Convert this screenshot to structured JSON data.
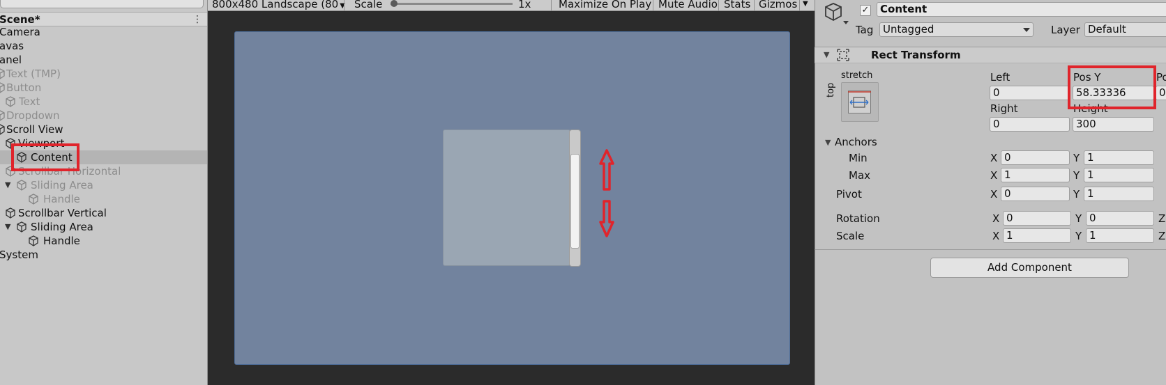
{
  "hierarchy": {
    "scene_title": "Scene*",
    "items": [
      {
        "label": "Camera"
      },
      {
        "label": "avas"
      },
      {
        "label": "anel"
      },
      {
        "label": "Text (TMP)"
      },
      {
        "label": "Button"
      },
      {
        "label": "Text"
      },
      {
        "label": "Dropdown"
      },
      {
        "label": "Scroll View"
      },
      {
        "label": "Viewport"
      },
      {
        "label": "Content"
      },
      {
        "label": "Scrollbar Horizontal"
      },
      {
        "label": "Sliding Area"
      },
      {
        "label": "Handle"
      },
      {
        "label": "Scrollbar Vertical"
      },
      {
        "label": "Sliding Area"
      },
      {
        "label": "Handle"
      },
      {
        "label": "System"
      }
    ]
  },
  "toolbar": {
    "resolution": "800x480 Landscape (80",
    "scale_label": "Scale",
    "scale_value": "1x",
    "maximize_on_play": "Maximize On Play",
    "mute_audio": "Mute Audio",
    "stats": "Stats",
    "gizmos": "Gizmos"
  },
  "inspector": {
    "object_name": "Content",
    "tag_label": "Tag",
    "tag_value": "Untagged",
    "layer_label": "Layer",
    "layer_value": "Default",
    "component_title": "Rect Transform",
    "anchor_preset_h": "stretch",
    "anchor_preset_v": "top",
    "left_label": "Left",
    "left_value": "0",
    "posy_label": "Pos Y",
    "posy_value": "58.33336",
    "posz_label": "Po",
    "posz_value": "0",
    "right_label": "Right",
    "right_value": "0",
    "height_label": "Height",
    "height_value": "300",
    "anchors_label": "Anchors",
    "min_label": "Min",
    "min_x": "0",
    "min_y": "1",
    "max_label": "Max",
    "max_x": "1",
    "max_y": "1",
    "pivot_label": "Pivot",
    "pivot_x": "0",
    "pivot_y": "1",
    "rotation_label": "Rotation",
    "rotation_x": "0",
    "rotation_y": "0",
    "scale_label": "Scale",
    "scale_x": "1",
    "scale_y": "1",
    "x_label": "X",
    "y_label": "Y",
    "z_label": "Z",
    "add_component": "Add Component"
  },
  "colors": {
    "highlight_red": "#e0242b",
    "canvas_blue": "#72839e"
  }
}
